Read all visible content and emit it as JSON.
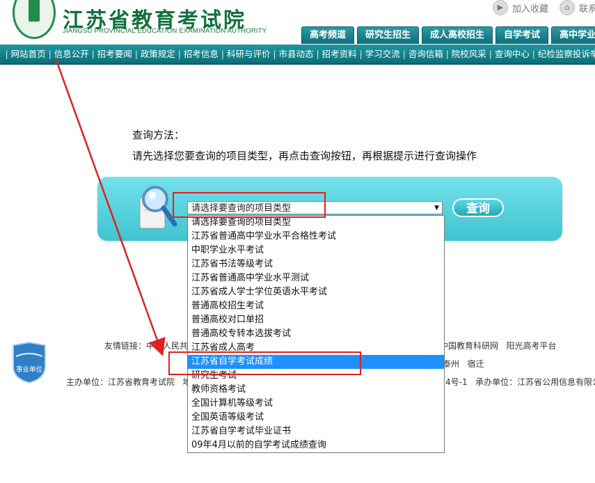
{
  "header": {
    "title": "江苏省教育考试院",
    "subtitle": "JIANGSU PROVINCIAL EDUCATION EXAMINATION AUTHORITY",
    "top_links": [
      {
        "label": "加入收藏",
        "icon": "bookmark-icon"
      },
      {
        "label": "联系我",
        "icon": "contact-icon"
      }
    ],
    "tabs": [
      "高考频道",
      "研究生招生",
      "成人高校招生",
      "自学考试",
      "高中学业水平"
    ]
  },
  "nav": {
    "items": [
      "网站首页",
      "信息公开",
      "招考要闻",
      "政策规定",
      "招考信息",
      "科研与评价",
      "市县动态",
      "招考资料",
      "学习交流",
      "咨询信箱",
      "院校风采",
      "查询中心",
      "纪检监察投诉举"
    ]
  },
  "instructions": {
    "title": "查询方法：",
    "text": "请先选择您要查询的项目类型，再点击查询按钮，再根据提示进行查询操作"
  },
  "query": {
    "select_value": "请选择要查询的项目类型",
    "button_label": "查询",
    "options": [
      "请选择要查询的项目类型",
      "江苏省普通高中学业水平合格性考试",
      "中职学业水平考试",
      "江苏省书法等级考试",
      "江苏省普通高中学业水平测试",
      "江苏省成人学士学位英语水平考试",
      "普通高校招生考试",
      "普通高校对口单招",
      "普通高校专转本选拔考试",
      "江苏省成人高考",
      "江苏省自学考试成绩",
      "研究生考试",
      "教师资格考试",
      "全国计算机等级考试",
      "全国英语等级考试",
      "江苏省自学考试毕业证书",
      "09年4月以前的自学考试成绩查询"
    ],
    "selected_index": 10
  },
  "footer": {
    "badge": "事业单位",
    "links_prefix": "友情链接：中华人民共",
    "links_right": [
      "中国教育科研网",
      "阳光高考平台"
    ],
    "city_partial": "泰州",
    "city": "宿迁",
    "host_prefix": "主办单位：江苏省教育考试院",
    "host_cut": "地",
    "host_suffix": "4号-1",
    "organizer": "承办单位：江苏省公用信息有限公"
  },
  "colors": {
    "brand_green": "#12713b",
    "nav_teal": "#0c6f79",
    "query_bar": "#4fcbd6",
    "annotation_red": "#e02020",
    "selection_blue": "#1e90ff"
  }
}
